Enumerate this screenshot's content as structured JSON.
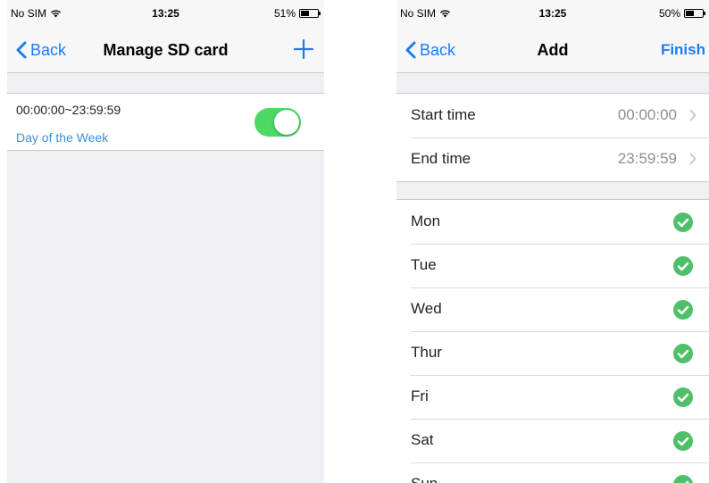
{
  "left_screen": {
    "status_bar": {
      "carrier": "No SIM",
      "time": "13:25",
      "battery_percent": "51%",
      "battery_level": 0.51
    },
    "nav": {
      "back_label": "Back",
      "title": "Manage SD card",
      "add_icon": "plus-icon"
    },
    "schedule": {
      "time_range": "00:00:00~23:59:59",
      "days_link": "Day of the Week",
      "enabled": true
    }
  },
  "right_screen": {
    "status_bar": {
      "carrier": "No SIM",
      "time": "13:25",
      "battery_percent": "50%",
      "battery_level": 0.5
    },
    "nav": {
      "back_label": "Back",
      "title": "Add",
      "finish_label": "Finish"
    },
    "times": [
      {
        "label": "Start time",
        "value": "00:00:00"
      },
      {
        "label": "End time",
        "value": "23:59:59"
      }
    ],
    "days": [
      {
        "label": "Mon",
        "checked": true
      },
      {
        "label": "Tue",
        "checked": true
      },
      {
        "label": "Wed",
        "checked": true
      },
      {
        "label": "Thur",
        "checked": true
      },
      {
        "label": "Fri",
        "checked": true
      },
      {
        "label": "Sat",
        "checked": true
      },
      {
        "label": "Sun",
        "checked": true
      }
    ]
  },
  "colors": {
    "accent": "#1a7cf5",
    "toggle_on": "#4cd964",
    "check": "#4fc06a",
    "link": "#3a8fd8",
    "background": "#efeff4"
  }
}
